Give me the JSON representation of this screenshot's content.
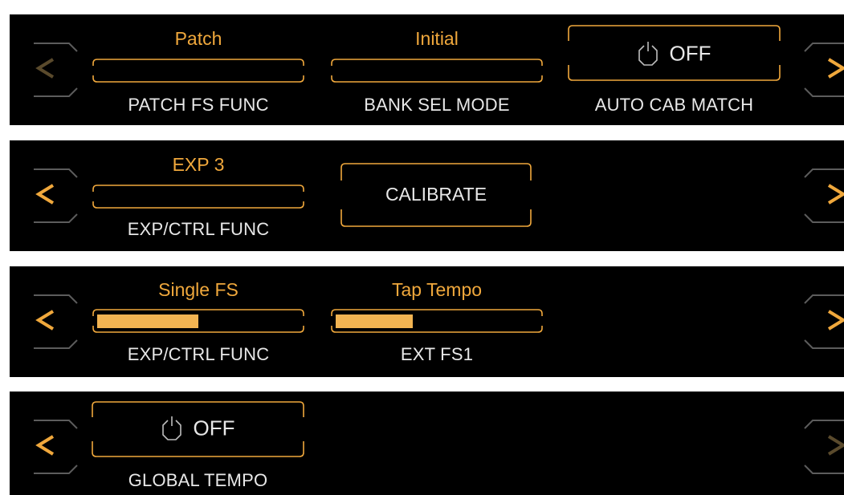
{
  "panels": [
    {
      "params": [
        {
          "value": "Patch",
          "label": "PATCH FS FUNC",
          "fill": 0
        },
        {
          "value": "Initial",
          "label": "BANK SEL MODE",
          "fill": 0
        }
      ],
      "toggle": {
        "state": "OFF",
        "label": "AUTO CAB MATCH",
        "icon": "power-icon"
      },
      "nav": {
        "left_enabled": false,
        "right_enabled": true
      }
    },
    {
      "params": [
        {
          "value": "EXP 3",
          "label": "EXP/CTRL FUNC",
          "fill": 0
        }
      ],
      "button": {
        "label": "CALIBRATE"
      },
      "nav": {
        "left_enabled": true,
        "right_enabled": true
      }
    },
    {
      "params": [
        {
          "value": "Single FS",
          "label": "EXP/CTRL FUNC",
          "fill": 0.5
        },
        {
          "value": "Tap Tempo",
          "label": "EXT FS1",
          "fill": 0.38
        }
      ],
      "nav": {
        "left_enabled": true,
        "right_enabled": true
      }
    },
    {
      "toggle": {
        "state": "OFF",
        "label": "GLOBAL TEMPO",
        "icon": "power-icon"
      },
      "nav": {
        "left_enabled": true,
        "right_enabled": false
      }
    }
  ],
  "colors": {
    "accent": "#f0a83c",
    "fill": "#f2b452",
    "disabled_arrow": "#5a4a2c",
    "frame_gray": "#5c5c5c",
    "text": "#e8e8e8",
    "panel_bg": "#000000"
  },
  "icons": {
    "left": "chevron-left-icon",
    "right": "chevron-right-icon",
    "power": "power-icon"
  }
}
